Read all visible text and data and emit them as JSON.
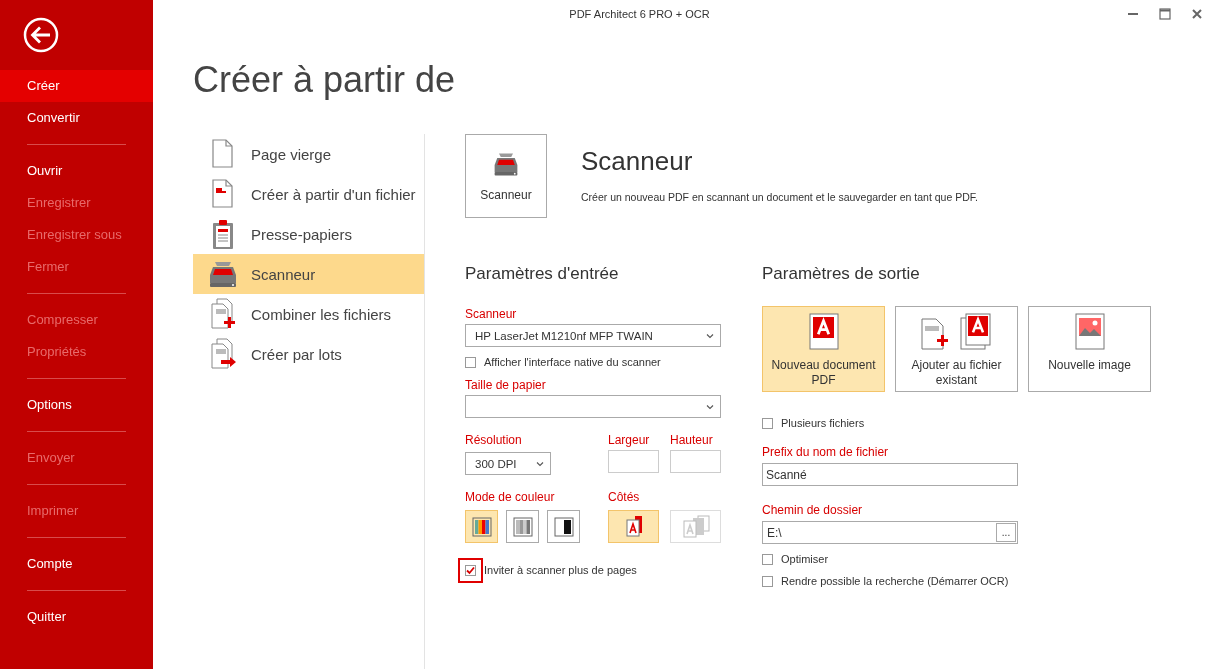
{
  "window": {
    "title": "PDF Architect 6 PRO + OCR"
  },
  "sidebar": {
    "groups": [
      {
        "items": [
          {
            "label": "Créer",
            "selected": true,
            "disabled": false
          },
          {
            "label": "Convertir",
            "selected": false,
            "disabled": false
          }
        ]
      },
      {
        "items": [
          {
            "label": "Ouvrir",
            "selected": false,
            "disabled": false
          },
          {
            "label": "Enregistrer",
            "selected": false,
            "disabled": true
          },
          {
            "label": "Enregistrer sous",
            "selected": false,
            "disabled": true
          },
          {
            "label": "Fermer",
            "selected": false,
            "disabled": true
          }
        ]
      },
      {
        "items": [
          {
            "label": "Compresser",
            "selected": false,
            "disabled": true
          },
          {
            "label": "Propriétés",
            "selected": false,
            "disabled": true
          }
        ]
      },
      {
        "items": [
          {
            "label": "Options",
            "selected": false,
            "disabled": false
          }
        ]
      },
      {
        "items": [
          {
            "label": "Envoyer",
            "selected": false,
            "disabled": true
          }
        ]
      },
      {
        "items": [
          {
            "label": "Imprimer",
            "selected": false,
            "disabled": true
          }
        ]
      },
      {
        "items": [
          {
            "label": "Compte",
            "selected": false,
            "disabled": false
          }
        ]
      },
      {
        "items": [
          {
            "label": "Quitter",
            "selected": false,
            "disabled": false
          }
        ]
      }
    ]
  },
  "page_title": "Créer à partir de",
  "create_list": {
    "items": [
      {
        "label": "Page vierge",
        "kind": "blank",
        "selected": false
      },
      {
        "label": "Créer à partir d'un fichier",
        "kind": "file",
        "selected": false
      },
      {
        "label": "Presse-papiers",
        "kind": "clipboard",
        "selected": false
      },
      {
        "label": "Scanneur",
        "kind": "scanner",
        "selected": true
      },
      {
        "label": "Combiner les fichiers",
        "kind": "combine",
        "selected": false
      },
      {
        "label": "Créer par lots",
        "kind": "batch",
        "selected": false
      }
    ]
  },
  "detail": {
    "tile_label": "Scanneur",
    "title": "Scanneur",
    "description": "Créer un nouveau PDF en scannant un document et le sauvegarder en tant que PDF."
  },
  "input_settings": {
    "heading": "Paramètres d'entrée",
    "scanner": {
      "label": "Scanneur",
      "value": "HP LaserJet M1210nf MFP TWAIN"
    },
    "native_ui": {
      "label": "Afficher l'interface native du scanner",
      "checked": false
    },
    "paper_size": {
      "label": "Taille de papier"
    },
    "resolution": {
      "label": "Résolution",
      "value": "300 DPI"
    },
    "width": {
      "label": "Largeur"
    },
    "height": {
      "label": "Hauteur"
    },
    "color_mode": {
      "label": "Mode de couleur",
      "options": [
        {
          "kind": "color",
          "selected": true
        },
        {
          "kind": "grayscale",
          "selected": false
        },
        {
          "kind": "black_white",
          "selected": false
        }
      ]
    },
    "sides": {
      "label": "Côtés",
      "options": [
        {
          "kind": "single",
          "selected": true,
          "disabled": false
        },
        {
          "kind": "duplex",
          "selected": false,
          "disabled": true
        }
      ]
    },
    "more_pages": {
      "label": "Inviter à scanner plus de pages",
      "checked": true,
      "focused": true
    }
  },
  "output_settings": {
    "heading": "Paramètres de sortie",
    "options": [
      {
        "label": "Nouveau document PDF",
        "kind": "new_pdf",
        "selected": true
      },
      {
        "label": "Ajouter au fichier existant",
        "kind": "append",
        "selected": false
      },
      {
        "label": "Nouvelle image",
        "kind": "image",
        "selected": false
      }
    ],
    "multiple_files": {
      "label": "Plusieurs fichiers",
      "checked": false
    },
    "prefix": {
      "label": "Prefix du nom de fichier",
      "value": "Scanné"
    },
    "folder": {
      "label": "Chemin de dossier",
      "value": "E:\\",
      "browse": "..."
    },
    "optimize": {
      "label": "Optimiser",
      "checked": false
    },
    "searchable": {
      "label": "Rendre possible la recherche (Démarrer OCR)",
      "checked": false
    }
  }
}
